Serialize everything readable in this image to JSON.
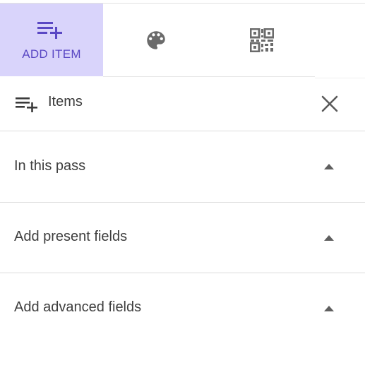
{
  "tabs": [
    {
      "label": "ADD ITEM",
      "icon": "playlist-add-icon",
      "active": true
    },
    {
      "label": "",
      "icon": "palette-icon",
      "active": false
    },
    {
      "label": "",
      "icon": "qr-code-icon",
      "active": false
    }
  ],
  "panel": {
    "title": "Items",
    "title_icon": "playlist-add-icon",
    "close_icon": "close-icon"
  },
  "sections": [
    {
      "title": "In this pass",
      "icon": "caret-up-icon"
    },
    {
      "title": "Add present fields",
      "icon": "caret-up-icon"
    },
    {
      "title": "Add advanced fields",
      "icon": "caret-up-icon"
    }
  ],
  "colors": {
    "accent": "#5a48c4",
    "active_tab_bg": "#d9d4fb",
    "icon_gray": "#6b6b6b",
    "text": "#3e3e3e",
    "divider": "#dcdcdc"
  }
}
